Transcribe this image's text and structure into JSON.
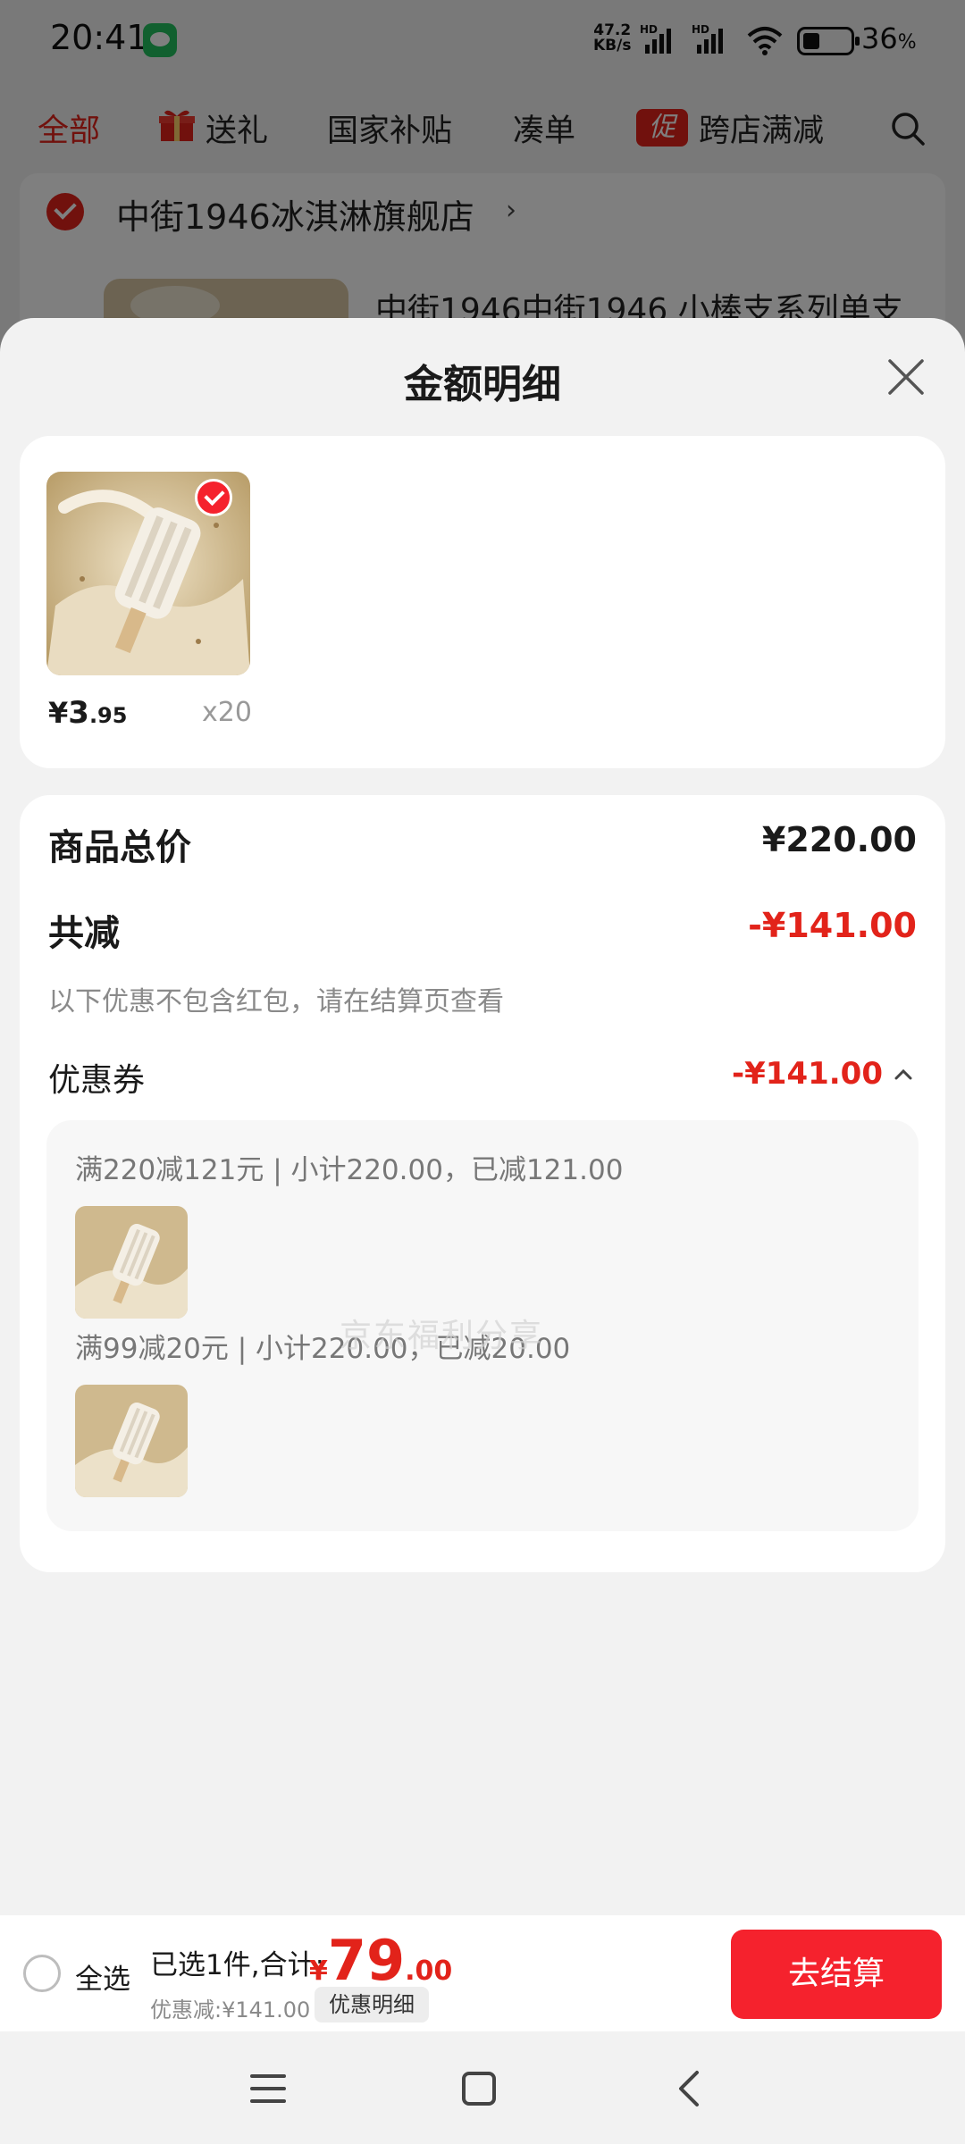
{
  "status_bar": {
    "time": "20:41",
    "net_speed_value": "47.2",
    "net_speed_unit": "KB/s",
    "hd_1": "HD",
    "hd_2": "HD",
    "battery_percent": "36",
    "battery_unit": "%",
    "icons": [
      "wechat-icon",
      "signal-icon",
      "wifi-icon",
      "battery-icon"
    ]
  },
  "top_tabs": [
    {
      "label": "全部",
      "active": true
    },
    {
      "label": "送礼",
      "active": false,
      "icon": "gift-icon"
    },
    {
      "label": "国家补贴",
      "active": false
    },
    {
      "label": "凑单",
      "active": false
    },
    {
      "label": "跨店满减",
      "active": false,
      "badge": "促"
    }
  ],
  "store": {
    "name": "中街1946冰淇淋旗舰店",
    "chevron": "›",
    "product_title": "中街1946中街1946 小棒支系列单支"
  },
  "sheet": {
    "title": "金额明细",
    "products": [
      {
        "price_symbol": "¥",
        "price_int": "3",
        "price_dec": ".95",
        "qty": "x20",
        "selected": true
      }
    ],
    "summary": {
      "total_label": "商品总价",
      "total_value": "¥220.00",
      "reduce_label": "共减",
      "reduce_value": "-¥141.00",
      "note": "以下优惠不包含红包，请在结算页查看",
      "coupon_label": "优惠券",
      "coupon_value": "-¥141.00",
      "coupon_rules": [
        {
          "text": "满220减121元 | 小计220.00，已减121.00"
        },
        {
          "text": "满99减20元 | 小计220.00，已减20.00"
        }
      ]
    },
    "watermark": "京东福利分享"
  },
  "checkout": {
    "select_all_label": "全选",
    "selected_text": "已选1件,合计:",
    "total_symbol": "¥",
    "total_int": "79",
    "total_dec": ".00",
    "discount_text": "优惠减:¥141.00",
    "detail_button": "优惠明细",
    "checkout_button": "去结算"
  },
  "colors": {
    "accent": "#e2231a",
    "button_red": "#f5222d",
    "sheet_bg": "#f2f2f2",
    "card_bg": "#ffffff"
  }
}
